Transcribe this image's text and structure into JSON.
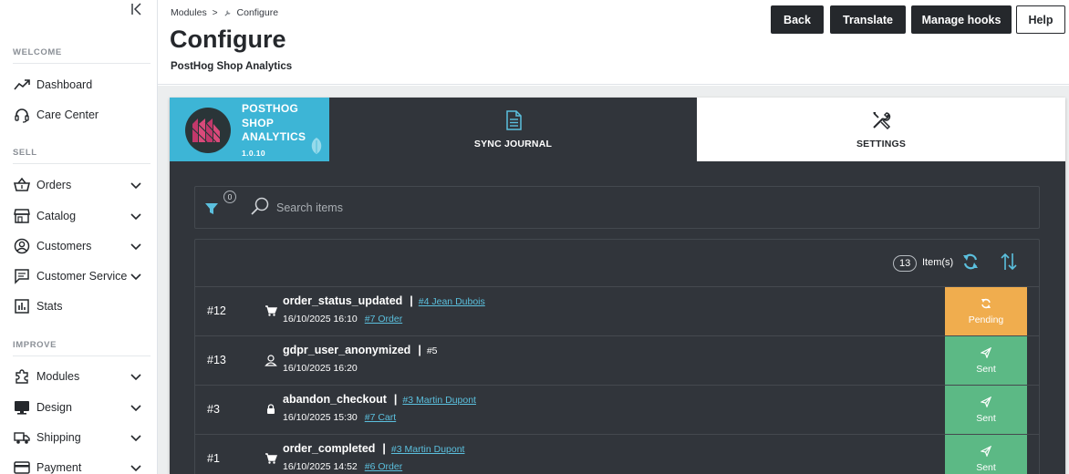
{
  "sidebar": {
    "sections": [
      {
        "label": "WELCOME"
      },
      {
        "label": "SELL"
      },
      {
        "label": "IMPROVE"
      }
    ],
    "items": [
      {
        "label": "Dashboard",
        "icon": "trending-up-icon"
      },
      {
        "label": "Care Center",
        "icon": "headset-icon"
      },
      {
        "label": "Orders",
        "icon": "basket-icon"
      },
      {
        "label": "Catalog",
        "icon": "store-icon"
      },
      {
        "label": "Customers",
        "icon": "user-circle-icon"
      },
      {
        "label": "Customer Service",
        "icon": "chat-icon"
      },
      {
        "label": "Stats",
        "icon": "bar-chart-icon"
      },
      {
        "label": "Modules",
        "icon": "puzzle-icon"
      },
      {
        "label": "Design",
        "icon": "monitor-icon"
      },
      {
        "label": "Shipping",
        "icon": "truck-icon"
      },
      {
        "label": "Payment",
        "icon": "credit-card-icon"
      }
    ]
  },
  "header": {
    "breadcrumb": [
      "Modules",
      "Configure"
    ],
    "title": "Configure",
    "subtitle": "PostHog Shop Analytics",
    "buttons": {
      "back": "Back",
      "translate": "Translate",
      "manage_hooks": "Manage hooks",
      "help": "Help"
    }
  },
  "module": {
    "logo_text": "POSTHOG SHOP ANALYTICS",
    "version": "1.0.10",
    "tabs": {
      "sync": "SYNC JOURNAL",
      "settings": "SETTINGS"
    },
    "filter_count": "0",
    "search_placeholder": "Search items",
    "item_count": "13",
    "item_label": "Item(s)"
  },
  "rows": [
    {
      "id": "#12",
      "icon": "cart-icon",
      "event": "order_status_updated",
      "customer": "#4 Jean Dubois",
      "customer_link": true,
      "date": "16/10/2025 16:10",
      "link": "#7 Order",
      "status": "Pending"
    },
    {
      "id": "#13",
      "icon": "user-icon",
      "event": "gdpr_user_anonymized",
      "customer": "#5",
      "customer_link": false,
      "date": "16/10/2025 16:20",
      "link": "",
      "status": "Sent"
    },
    {
      "id": "#3",
      "icon": "lock-icon",
      "event": "abandon_checkout",
      "customer": "#3 Martin Dupont",
      "customer_link": true,
      "date": "16/10/2025 15:30",
      "link": "#7 Cart",
      "status": "Sent"
    },
    {
      "id": "#1",
      "icon": "cart-icon",
      "event": "order_completed",
      "customer": "#3 Martin Dupont",
      "customer_link": true,
      "date": "16/10/2025 14:52",
      "link": "#6 Order",
      "status": "Sent"
    }
  ],
  "colors": {
    "pending": "#f0ad4e",
    "sent": "#5cb985",
    "accent": "#3db5d6",
    "dark": "#31353b"
  }
}
